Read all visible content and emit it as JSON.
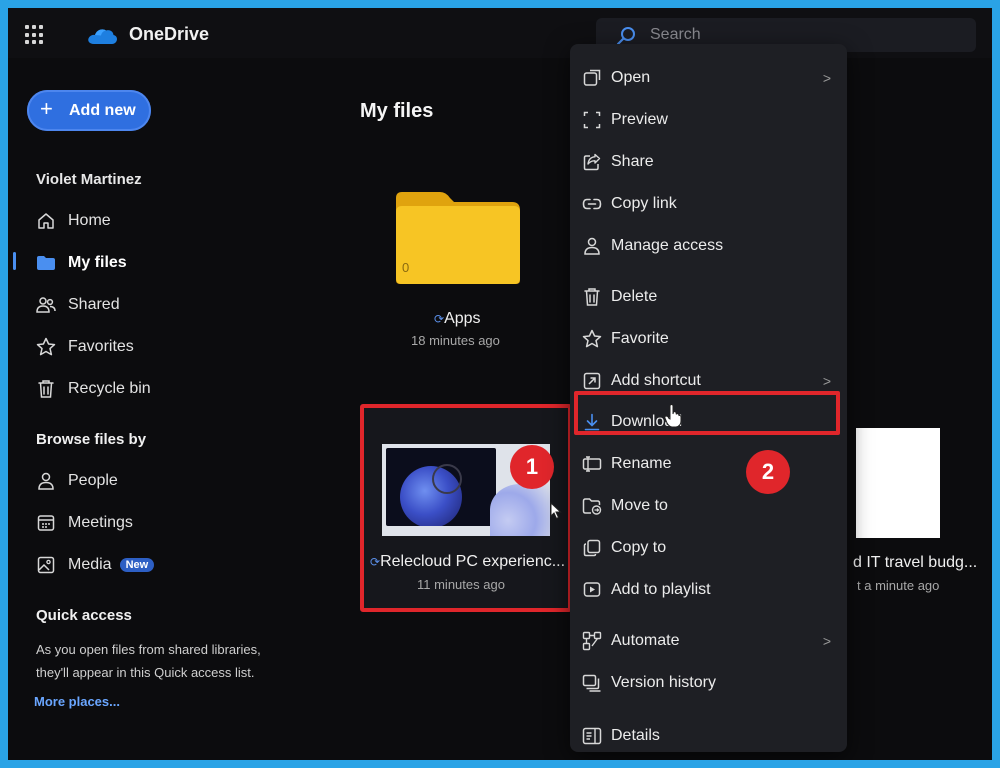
{
  "app": {
    "name": "OneDrive"
  },
  "search": {
    "placeholder": "Search"
  },
  "sidebar": {
    "add_new_label": "Add new",
    "user_name": "Violet Martinez",
    "nav": [
      {
        "label": "Home",
        "icon": "home-icon"
      },
      {
        "label": "My files",
        "icon": "folder-icon",
        "active": true
      },
      {
        "label": "Shared",
        "icon": "people-icon"
      },
      {
        "label": "Favorites",
        "icon": "star-icon"
      },
      {
        "label": "Recycle bin",
        "icon": "trash-icon"
      }
    ],
    "browse_heading": "Browse files by",
    "browse": [
      {
        "label": "People",
        "icon": "person-icon"
      },
      {
        "label": "Meetings",
        "icon": "calendar-icon"
      },
      {
        "label": "Media",
        "icon": "image-icon",
        "badge": "New"
      }
    ],
    "quick_access_heading": "Quick access",
    "quick_access_text": "As you open files from shared libraries, they'll appear in this Quick access list.",
    "more_places": "More places..."
  },
  "main": {
    "title": "My files",
    "items": [
      {
        "name": "Apps",
        "modified": "18 minutes ago",
        "count": "0",
        "kind": "folder"
      },
      {
        "name": "Relecloud PC experienc...",
        "modified": "11 minutes ago",
        "kind": "file",
        "selected": true
      },
      {
        "name": "d IT travel budg...",
        "modified": "t a minute ago",
        "kind": "file"
      }
    ]
  },
  "context_menu": {
    "items": [
      {
        "label": "Open",
        "icon": "open-icon",
        "submenu": true
      },
      {
        "label": "Preview",
        "icon": "preview-icon"
      },
      {
        "label": "Share",
        "icon": "share-icon"
      },
      {
        "label": "Copy link",
        "icon": "link-icon"
      },
      {
        "label": "Manage access",
        "icon": "person-icon"
      },
      {
        "label": "Delete",
        "icon": "trash-icon"
      },
      {
        "label": "Favorite",
        "icon": "star-icon"
      },
      {
        "label": "Add shortcut",
        "icon": "shortcut-icon",
        "submenu": true
      },
      {
        "label": "Download",
        "icon": "download-icon",
        "highlighted": true
      },
      {
        "label": "Rename",
        "icon": "rename-icon"
      },
      {
        "label": "Move to",
        "icon": "move-icon"
      },
      {
        "label": "Copy to",
        "icon": "copy-icon"
      },
      {
        "label": "Add to playlist",
        "icon": "playlist-icon"
      },
      {
        "label": "Automate",
        "icon": "automate-icon",
        "submenu": true
      },
      {
        "label": "Version history",
        "icon": "history-icon"
      },
      {
        "label": "Details",
        "icon": "details-icon"
      }
    ]
  },
  "annotations": {
    "step1": "1",
    "step2": "2"
  },
  "colors": {
    "accent": "#2f6fe0",
    "highlight": "#e0262b",
    "folder": "#f5c518",
    "frame": "#2aa3e6"
  }
}
